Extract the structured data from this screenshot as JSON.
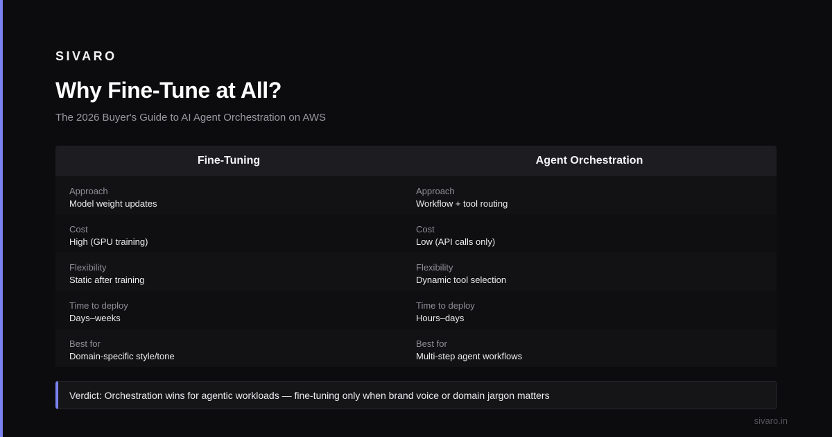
{
  "brand": "SIVARO",
  "title": "Why Fine-Tune at All?",
  "subtitle": "The 2026 Buyer's Guide to AI Agent Orchestration on AWS",
  "table": {
    "columns": [
      "Fine-Tuning",
      "Agent Orchestration"
    ],
    "rows": [
      {
        "label": "Approach",
        "left": "Model weight updates",
        "right": "Workflow + tool routing"
      },
      {
        "label": "Cost",
        "left": "High (GPU training)",
        "right": "Low (API calls only)"
      },
      {
        "label": "Flexibility",
        "left": "Static after training",
        "right": "Dynamic tool selection"
      },
      {
        "label": "Time to deploy",
        "left": "Days–weeks",
        "right": "Hours–days"
      },
      {
        "label": "Best for",
        "left": "Domain-specific style/tone",
        "right": "Multi-step agent workflows"
      }
    ]
  },
  "verdict": "Verdict: Orchestration wins for agentic workloads — fine-tuning only when brand voice or domain jargon matters",
  "footer": "sivaro.in",
  "colors": {
    "background": "#0c0c0e",
    "accent": "#7a82f0"
  }
}
